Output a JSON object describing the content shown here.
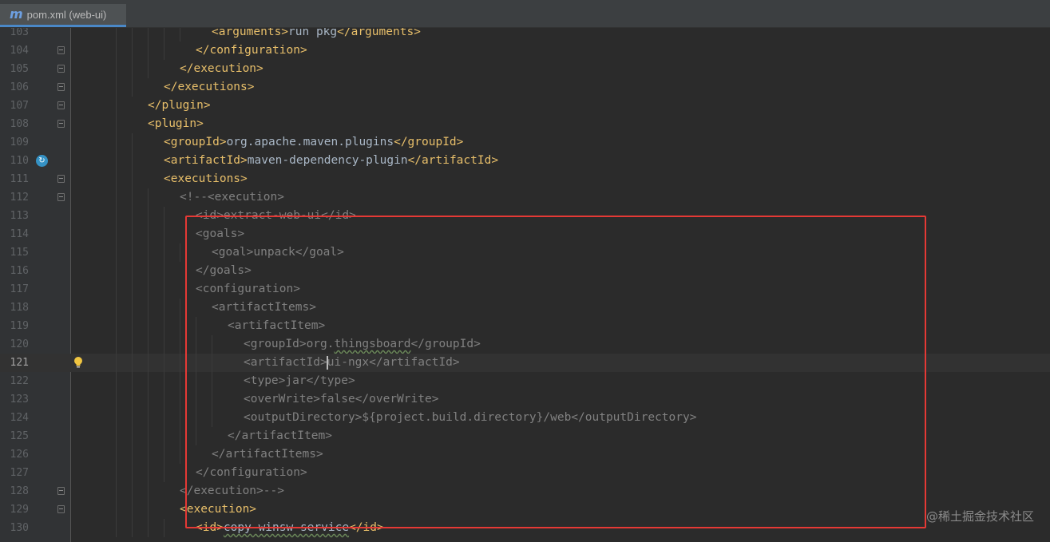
{
  "tab": {
    "icon": "maven-m-icon",
    "icon_glyph": "m",
    "label": "pom.xml (web-ui)"
  },
  "colors": {
    "tag": "#e8bf6a",
    "text": "#a9b7c6",
    "comment": "#808080",
    "highlight_box": "#e53935"
  },
  "lines": [
    {
      "n": "103",
      "indent": 12,
      "parts": [
        [
          "tag",
          "<arguments>"
        ],
        [
          "txt",
          "run pkg"
        ],
        [
          "tag",
          "</arguments>"
        ]
      ]
    },
    {
      "n": "104",
      "indent": 10,
      "fold": true,
      "parts": [
        [
          "tag",
          "</configuration>"
        ]
      ]
    },
    {
      "n": "105",
      "indent": 8,
      "fold": true,
      "parts": [
        [
          "tag",
          "</execution>"
        ]
      ]
    },
    {
      "n": "106",
      "indent": 6,
      "fold": true,
      "parts": [
        [
          "tag",
          "</executions>"
        ]
      ]
    },
    {
      "n": "107",
      "indent": 4,
      "fold": true,
      "parts": [
        [
          "tag",
          "</plugin>"
        ]
      ]
    },
    {
      "n": "108",
      "indent": 4,
      "fold": true,
      "parts": [
        [
          "tag",
          "<plugin>"
        ]
      ]
    },
    {
      "n": "109",
      "indent": 6,
      "parts": [
        [
          "tag",
          "<groupId>"
        ],
        [
          "txt",
          "org.apache.maven.plugins"
        ],
        [
          "tag",
          "</groupId>"
        ]
      ]
    },
    {
      "n": "110",
      "indent": 6,
      "marker": true,
      "parts": [
        [
          "tag",
          "<artifactId>"
        ],
        [
          "txt",
          "maven-dependency-plugin"
        ],
        [
          "tag",
          "</artifactId>"
        ]
      ]
    },
    {
      "n": "111",
      "indent": 6,
      "fold": true,
      "parts": [
        [
          "tag",
          "<executions>"
        ]
      ]
    },
    {
      "n": "112",
      "indent": 8,
      "fold": true,
      "parts": [
        [
          "cmt",
          "<!--<execution>"
        ]
      ]
    },
    {
      "n": "113",
      "indent": 10,
      "parts": [
        [
          "cmt",
          "<id>extract-web-ui</id>"
        ]
      ]
    },
    {
      "n": "114",
      "indent": 10,
      "parts": [
        [
          "cmt",
          "<goals>"
        ]
      ]
    },
    {
      "n": "115",
      "indent": 12,
      "parts": [
        [
          "cmt",
          "<goal>unpack</goal>"
        ]
      ]
    },
    {
      "n": "116",
      "indent": 10,
      "parts": [
        [
          "cmt",
          "</goals>"
        ]
      ]
    },
    {
      "n": "117",
      "indent": 10,
      "parts": [
        [
          "cmt",
          "<configuration>"
        ]
      ]
    },
    {
      "n": "118",
      "indent": 12,
      "parts": [
        [
          "cmt",
          "<artifactItems>"
        ]
      ]
    },
    {
      "n": "119",
      "indent": 14,
      "parts": [
        [
          "cmt",
          "<artifactItem>"
        ]
      ]
    },
    {
      "n": "120",
      "indent": 16,
      "parts": [
        [
          "cmt",
          "<groupId>org."
        ],
        [
          "cmtsq",
          "thingsboard"
        ],
        [
          "cmt",
          "</groupId>"
        ]
      ]
    },
    {
      "n": "121",
      "indent": 16,
      "current": true,
      "bulb": true,
      "parts": [
        [
          "cmt",
          "<artifactId>"
        ],
        [
          "caret",
          ""
        ],
        [
          "cmt",
          "ui-ngx</artifactId>"
        ]
      ]
    },
    {
      "n": "122",
      "indent": 16,
      "parts": [
        [
          "cmt",
          "<type>jar</type>"
        ]
      ]
    },
    {
      "n": "123",
      "indent": 16,
      "parts": [
        [
          "cmt",
          "<overWrite>false</overWrite>"
        ]
      ]
    },
    {
      "n": "124",
      "indent": 16,
      "parts": [
        [
          "cmt",
          "<outputDirectory>${project.build.directory}/web</outputDirectory>"
        ]
      ]
    },
    {
      "n": "125",
      "indent": 14,
      "parts": [
        [
          "cmt",
          "</artifactItem>"
        ]
      ]
    },
    {
      "n": "126",
      "indent": 12,
      "parts": [
        [
          "cmt",
          "</artifactItems>"
        ]
      ]
    },
    {
      "n": "127",
      "indent": 10,
      "parts": [
        [
          "cmt",
          "</configuration>"
        ]
      ]
    },
    {
      "n": "128",
      "indent": 8,
      "fold": true,
      "parts": [
        [
          "cmt",
          "</execution>-->"
        ]
      ]
    },
    {
      "n": "129",
      "indent": 8,
      "fold": true,
      "parts": [
        [
          "tag",
          "<execution>"
        ]
      ]
    },
    {
      "n": "130",
      "indent": 10,
      "parts": [
        [
          "tag",
          "<id>"
        ],
        [
          "txtsq",
          "copy-winsw-service"
        ],
        [
          "tag",
          "</id>"
        ]
      ]
    }
  ],
  "watermark": "@稀土掘金技术社区"
}
